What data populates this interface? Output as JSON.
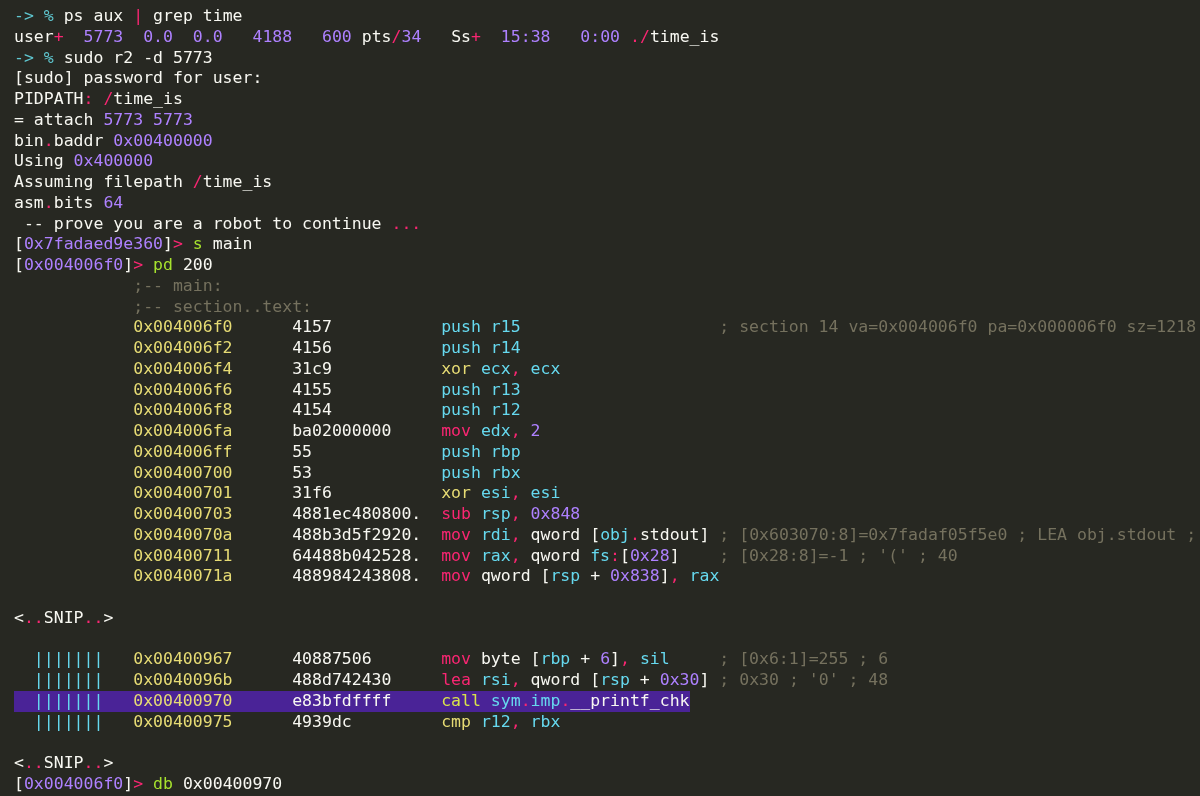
{
  "terminal": {
    "lines": [
      {
        "kind": "text",
        "tokens": [
          {
            "kind": "prompt",
            "t": "-> % "
          },
          {
            "kind": "plain",
            "t": "ps aux "
          },
          {
            "kind": "punct",
            "t": "|"
          },
          {
            "kind": "plain",
            "t": " grep time"
          }
        ]
      },
      {
        "kind": "text",
        "tokens": [
          {
            "kind": "plain",
            "t": "user"
          },
          {
            "kind": "punct",
            "t": "+"
          },
          {
            "kind": "num",
            "t": "  5773"
          },
          {
            "kind": "num",
            "t": "  0.0"
          },
          {
            "kind": "num",
            "t": "  0.0"
          },
          {
            "kind": "num",
            "t": "   4188"
          },
          {
            "kind": "num",
            "t": "   600"
          },
          {
            "kind": "plain",
            "t": " pts"
          },
          {
            "kind": "punct",
            "t": "/"
          },
          {
            "kind": "num",
            "t": "34"
          },
          {
            "kind": "plain",
            "t": "   Ss"
          },
          {
            "kind": "punct",
            "t": "+"
          },
          {
            "kind": "num",
            "t": "  15:38"
          },
          {
            "kind": "num",
            "t": "   0:00"
          },
          {
            "kind": "punct",
            "t": " ./"
          },
          {
            "kind": "plain",
            "t": "time_is"
          }
        ]
      },
      {
        "kind": "text",
        "tokens": [
          {
            "kind": "prompt",
            "t": "-> % "
          },
          {
            "kind": "plain",
            "t": "sudo r2 -d 5773"
          }
        ]
      },
      {
        "kind": "text",
        "tokens": [
          {
            "kind": "plain",
            "t": "[sudo] password for user:"
          }
        ]
      },
      {
        "kind": "text",
        "tokens": [
          {
            "kind": "plain",
            "t": "PIDPATH"
          },
          {
            "kind": "punct",
            "t": ": /"
          },
          {
            "kind": "plain",
            "t": "time_is"
          }
        ]
      },
      {
        "kind": "text",
        "tokens": [
          {
            "kind": "plain",
            "t": "= attach "
          },
          {
            "kind": "num",
            "t": "5773 5773"
          }
        ]
      },
      {
        "kind": "text",
        "tokens": [
          {
            "kind": "plain",
            "t": "bin"
          },
          {
            "kind": "punct",
            "t": "."
          },
          {
            "kind": "plain",
            "t": "baddr "
          },
          {
            "kind": "num",
            "t": "0x00400000"
          }
        ]
      },
      {
        "kind": "text",
        "tokens": [
          {
            "kind": "plain",
            "t": "Using "
          },
          {
            "kind": "num",
            "t": "0x400000"
          }
        ]
      },
      {
        "kind": "text",
        "tokens": [
          {
            "kind": "plain",
            "t": "Assuming filepath "
          },
          {
            "kind": "punct",
            "t": "/"
          },
          {
            "kind": "plain",
            "t": "time_is"
          }
        ]
      },
      {
        "kind": "text",
        "tokens": [
          {
            "kind": "plain",
            "t": "asm"
          },
          {
            "kind": "punct",
            "t": "."
          },
          {
            "kind": "plain",
            "t": "bits "
          },
          {
            "kind": "num",
            "t": "64"
          }
        ]
      },
      {
        "kind": "motd",
        "tokens": [
          {
            "kind": "plain",
            "t": "-- prove you are a robot to continue "
          },
          {
            "kind": "punct",
            "t": "..."
          }
        ]
      },
      {
        "kind": "text",
        "tokens": [
          {
            "kind": "plain",
            "t": "["
          },
          {
            "kind": "num",
            "t": "0x7fadaed9e360"
          },
          {
            "kind": "plain",
            "t": "]"
          },
          {
            "kind": "punct",
            "t": "> "
          },
          {
            "kind": "cmd",
            "t": "s"
          },
          {
            "kind": "plain",
            "t": " main"
          }
        ]
      },
      {
        "kind": "text",
        "tokens": [
          {
            "kind": "plain",
            "t": "["
          },
          {
            "kind": "num",
            "t": "0x004006f0"
          },
          {
            "kind": "plain",
            "t": "]"
          },
          {
            "kind": "punct",
            "t": "> "
          },
          {
            "kind": "cmd",
            "t": "pd"
          },
          {
            "kind": "plain",
            "t": " 200"
          }
        ]
      },
      {
        "kind": "label",
        "tokens": [
          {
            "kind": "comment",
            "t": ";-- main:"
          }
        ]
      },
      {
        "kind": "label",
        "tokens": [
          {
            "kind": "comment",
            "t": ";-- section..text:"
          }
        ]
      },
      {
        "kind": "disasm",
        "addr": "0x004006f0",
        "bytes": "4157",
        "instr": [
          {
            "kind": "op_stack",
            "t": "push "
          },
          {
            "kind": "reg",
            "t": "r15"
          }
        ],
        "comment": "; section 14 va=0x004006f0 pa=0x000006f0 sz=1218"
      },
      {
        "kind": "disasm",
        "addr": "0x004006f2",
        "bytes": "4156",
        "instr": [
          {
            "kind": "op_stack",
            "t": "push "
          },
          {
            "kind": "reg",
            "t": "r14"
          }
        ]
      },
      {
        "kind": "disasm",
        "addr": "0x004006f4",
        "bytes": "31c9",
        "instr": [
          {
            "kind": "op_logic",
            "t": "xor "
          },
          {
            "kind": "reg",
            "t": "ecx"
          },
          {
            "kind": "punct",
            "t": ", "
          },
          {
            "kind": "reg",
            "t": "ecx"
          }
        ]
      },
      {
        "kind": "disasm",
        "addr": "0x004006f6",
        "bytes": "4155",
        "instr": [
          {
            "kind": "op_stack",
            "t": "push "
          },
          {
            "kind": "reg",
            "t": "r13"
          }
        ]
      },
      {
        "kind": "disasm",
        "addr": "0x004006f8",
        "bytes": "4154",
        "instr": [
          {
            "kind": "op_stack",
            "t": "push "
          },
          {
            "kind": "reg",
            "t": "r12"
          }
        ]
      },
      {
        "kind": "disasm",
        "addr": "0x004006fa",
        "bytes": "ba02000000",
        "instr": [
          {
            "kind": "op_data",
            "t": "mov "
          },
          {
            "kind": "reg",
            "t": "edx"
          },
          {
            "kind": "punct",
            "t": ", "
          },
          {
            "kind": "num",
            "t": "2"
          }
        ]
      },
      {
        "kind": "disasm",
        "addr": "0x004006ff",
        "bytes": "55",
        "instr": [
          {
            "kind": "op_stack",
            "t": "push "
          },
          {
            "kind": "reg",
            "t": "rbp"
          }
        ]
      },
      {
        "kind": "disasm",
        "addr": "0x00400700",
        "bytes": "53",
        "instr": [
          {
            "kind": "op_stack",
            "t": "push "
          },
          {
            "kind": "reg",
            "t": "rbx"
          }
        ]
      },
      {
        "kind": "disasm",
        "addr": "0x00400701",
        "bytes": "31f6",
        "instr": [
          {
            "kind": "op_logic",
            "t": "xor "
          },
          {
            "kind": "reg",
            "t": "esi"
          },
          {
            "kind": "punct",
            "t": ", "
          },
          {
            "kind": "reg",
            "t": "esi"
          }
        ]
      },
      {
        "kind": "disasm",
        "addr": "0x00400703",
        "bytes": "4881ec480800.",
        "instr": [
          {
            "kind": "op_data",
            "t": "sub "
          },
          {
            "kind": "reg",
            "t": "rsp"
          },
          {
            "kind": "punct",
            "t": ", "
          },
          {
            "kind": "num",
            "t": "0x848"
          }
        ]
      },
      {
        "kind": "disasm",
        "addr": "0x0040070a",
        "bytes": "488b3d5f2920.",
        "instr": [
          {
            "kind": "op_data",
            "t": "mov "
          },
          {
            "kind": "reg",
            "t": "rdi"
          },
          {
            "kind": "punct",
            "t": ", "
          },
          {
            "kind": "plain",
            "t": "qword ["
          },
          {
            "kind": "reg",
            "t": "obj"
          },
          {
            "kind": "punct",
            "t": "."
          },
          {
            "kind": "plain",
            "t": "stdout]"
          }
        ],
        "comment": "; [0x603070:8]=0x7fadaf05f5e0 ; LEA obj.stdout ;"
      },
      {
        "kind": "disasm",
        "addr": "0x00400711",
        "bytes": "64488b042528.",
        "instr": [
          {
            "kind": "op_data",
            "t": "mov "
          },
          {
            "kind": "reg",
            "t": "rax"
          },
          {
            "kind": "punct",
            "t": ", "
          },
          {
            "kind": "plain",
            "t": "qword "
          },
          {
            "kind": "reg",
            "t": "fs"
          },
          {
            "kind": "punct",
            "t": ":"
          },
          {
            "kind": "plain",
            "t": "["
          },
          {
            "kind": "num",
            "t": "0x28"
          },
          {
            "kind": "plain",
            "t": "]"
          }
        ],
        "comment": "; [0x28:8]=-1 ; '(' ; 40"
      },
      {
        "kind": "disasm",
        "addr": "0x0040071a",
        "bytes": "488984243808.",
        "instr": [
          {
            "kind": "op_data",
            "t": "mov "
          },
          {
            "kind": "plain",
            "t": "qword ["
          },
          {
            "kind": "reg",
            "t": "rsp"
          },
          {
            "kind": "plain",
            "t": " + "
          },
          {
            "kind": "num",
            "t": "0x838"
          },
          {
            "kind": "plain",
            "t": "]"
          },
          {
            "kind": "punct",
            "t": ", "
          },
          {
            "kind": "reg",
            "t": "rax"
          }
        ]
      },
      {
        "kind": "blank"
      },
      {
        "kind": "text",
        "tokens": [
          {
            "kind": "plain",
            "t": "<"
          },
          {
            "kind": "punct",
            "t": ".."
          },
          {
            "kind": "plain",
            "t": "SNIP"
          },
          {
            "kind": "punct",
            "t": ".."
          },
          {
            "kind": "plain",
            "t": ">"
          }
        ]
      },
      {
        "kind": "blank"
      },
      {
        "kind": "disasm",
        "flow": "|||||||",
        "addr": "0x00400967",
        "bytes": "40887506",
        "instr": [
          {
            "kind": "op_data",
            "t": "mov "
          },
          {
            "kind": "plain",
            "t": "byte ["
          },
          {
            "kind": "reg",
            "t": "rbp"
          },
          {
            "kind": "plain",
            "t": " + "
          },
          {
            "kind": "num",
            "t": "6"
          },
          {
            "kind": "plain",
            "t": "]"
          },
          {
            "kind": "punct",
            "t": ", "
          },
          {
            "kind": "reg",
            "t": "sil"
          }
        ],
        "comment": "; [0x6:1]=255 ; 6",
        "selected": false
      },
      {
        "kind": "disasm",
        "flow": "|||||||",
        "addr": "0x0040096b",
        "bytes": "488d742430",
        "instr": [
          {
            "kind": "op_data",
            "t": "lea "
          },
          {
            "kind": "reg",
            "t": "rsi"
          },
          {
            "kind": "punct",
            "t": ", "
          },
          {
            "kind": "plain",
            "t": "qword ["
          },
          {
            "kind": "reg",
            "t": "rsp"
          },
          {
            "kind": "plain",
            "t": " + "
          },
          {
            "kind": "num",
            "t": "0x30"
          },
          {
            "kind": "plain",
            "t": "]"
          }
        ],
        "comment": "; 0x30 ; '0' ; 48",
        "selected": false
      },
      {
        "kind": "disasm",
        "flow": "|||||||",
        "addr": "0x00400970",
        "bytes": "e83bfdffff",
        "instr": [
          {
            "kind": "op_call",
            "t": "call "
          },
          {
            "kind": "reg",
            "t": "sym"
          },
          {
            "kind": "punct",
            "t": "."
          },
          {
            "kind": "reg",
            "t": "imp"
          },
          {
            "kind": "punct",
            "t": "."
          },
          {
            "kind": "plain",
            "t": "__printf_chk"
          }
        ],
        "selected": true
      },
      {
        "kind": "disasm",
        "flow": "|||||||",
        "addr": "0x00400975",
        "bytes": "4939dc",
        "instr": [
          {
            "kind": "op_logic",
            "t": "cmp "
          },
          {
            "kind": "reg",
            "t": "r12"
          },
          {
            "kind": "punct",
            "t": ", "
          },
          {
            "kind": "reg",
            "t": "rbx"
          }
        ],
        "selected": false
      },
      {
        "kind": "blank"
      },
      {
        "kind": "text",
        "tokens": [
          {
            "kind": "plain",
            "t": "<"
          },
          {
            "kind": "punct",
            "t": ".."
          },
          {
            "kind": "plain",
            "t": "SNIP"
          },
          {
            "kind": "punct",
            "t": ".."
          },
          {
            "kind": "plain",
            "t": ">"
          }
        ]
      },
      {
        "kind": "text",
        "tokens": [
          {
            "kind": "plain",
            "t": "["
          },
          {
            "kind": "num",
            "t": "0x004006f0"
          },
          {
            "kind": "plain",
            "t": "]"
          },
          {
            "kind": "punct",
            "t": "> "
          },
          {
            "kind": "cmd",
            "t": "db"
          },
          {
            "kind": "plain",
            "t": " 0x00400970"
          }
        ]
      }
    ]
  }
}
